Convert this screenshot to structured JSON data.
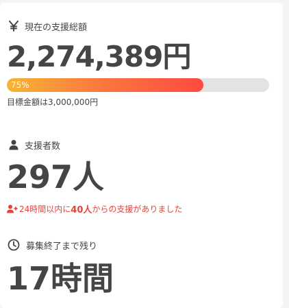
{
  "amount": {
    "icon": "yen-icon",
    "label": "現在の支援総額",
    "value": "2,274,389円",
    "progress_percent": 75,
    "progress_label": "75%",
    "goal_text": "目標金額は3,000,000円"
  },
  "supporters": {
    "icon": "person-icon",
    "label": "支援者数",
    "value": "297人",
    "note_prefix": "24時間以内に",
    "note_count": "40人",
    "note_suffix": "からの支援がありました",
    "note_icon": "user-plus-icon"
  },
  "time_left": {
    "icon": "clock-icon",
    "label": "募集終了まで残り",
    "value": "17時間"
  },
  "colors": {
    "progress_start": "#f6b534",
    "progress_end": "#fd4a40",
    "accent_red": "#e8423a",
    "text_dark": "#454545"
  }
}
